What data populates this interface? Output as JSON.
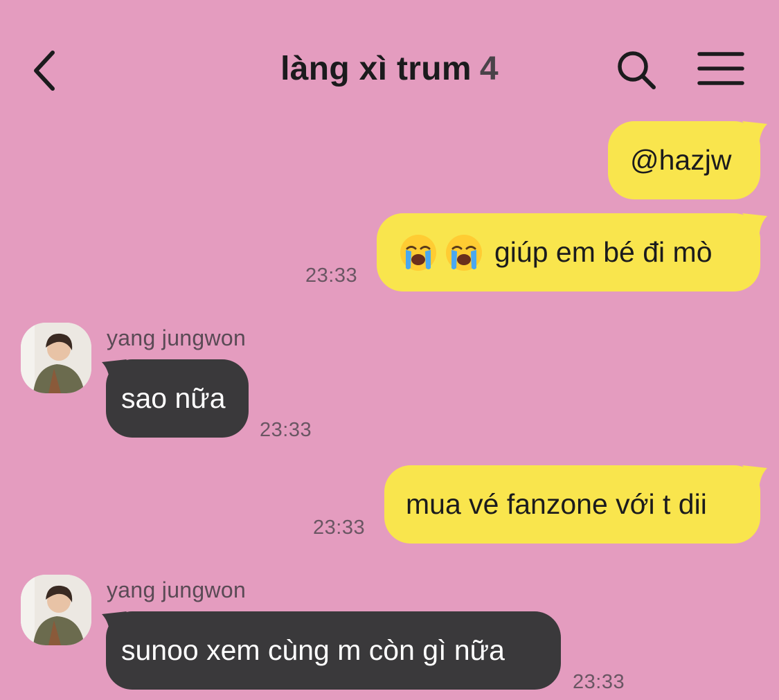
{
  "header": {
    "title": "làng xì trum",
    "member_count": "4",
    "back_icon": "chevron-left-icon",
    "search_icon": "search-icon",
    "menu_icon": "menu-icon"
  },
  "colors": {
    "background": "#e49cbf",
    "my_bubble": "#f9e54d",
    "their_bubble": "#3a393b"
  },
  "messages": [
    {
      "from": "me",
      "text": "@hazjw",
      "time": ""
    },
    {
      "from": "me",
      "text": "giúp em bé đi mò",
      "emoji": [
        "loudly-crying-face",
        "loudly-crying-face"
      ],
      "time": "23:33"
    },
    {
      "from": "yang jungwon",
      "sender": "yang jungwon",
      "text": "sao nữa",
      "time": "23:33"
    },
    {
      "from": "me",
      "text": "mua vé fanzone với t dii",
      "time": "23:33"
    },
    {
      "from": "yang jungwon",
      "sender": "yang jungwon",
      "text": "sunoo xem cùng m còn gì nữa",
      "time": "23:33"
    }
  ]
}
